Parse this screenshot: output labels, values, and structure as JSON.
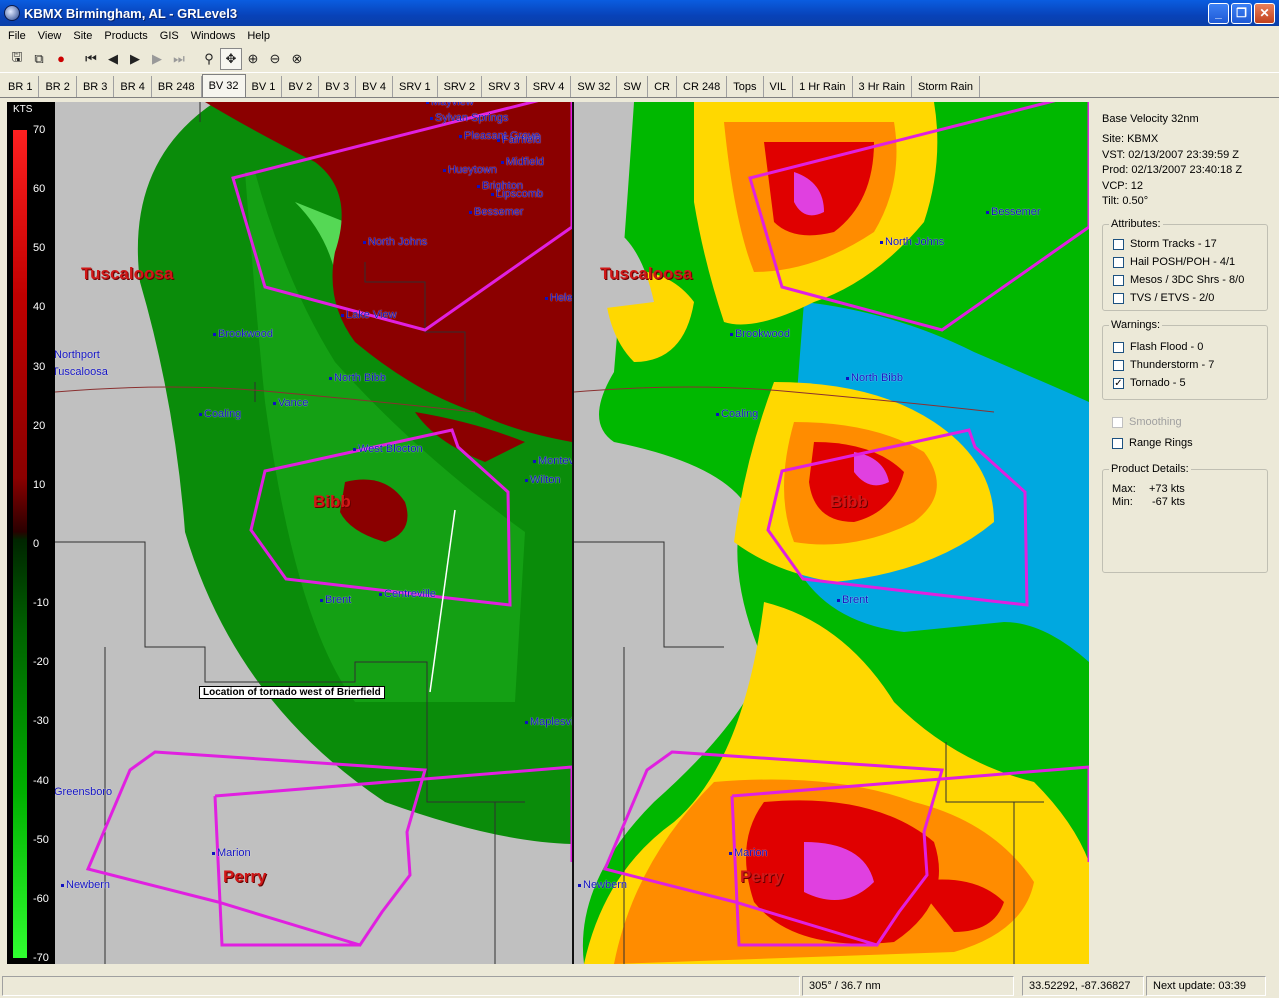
{
  "window": {
    "title": "KBMX Birmingham, AL - GRLevel3",
    "minimize": "_",
    "maximize": "❐",
    "close": "✕"
  },
  "menu": [
    "File",
    "View",
    "Site",
    "Products",
    "GIS",
    "Windows",
    "Help"
  ],
  "toolbar_icons": [
    "open-icon",
    "copy-icon",
    "delete-icon",
    "first-frame-icon",
    "prev-frame-icon",
    "play-icon",
    "next-frame-icon",
    "last-frame-icon",
    "zoom-icon",
    "pan-icon",
    "zoom-in-icon",
    "zoom-out-icon",
    "zoom-reset-icon"
  ],
  "tabs": [
    "BR 1",
    "BR 2",
    "BR 3",
    "BR 4",
    "BR 248",
    "BV 32",
    "BV 1",
    "BV 2",
    "BV 3",
    "BV 4",
    "SRV 1",
    "SRV 2",
    "SRV 3",
    "SRV 4",
    "SW 32",
    "SW",
    "CR",
    "CR 248",
    "Tops",
    "VIL",
    "1 Hr Rain",
    "3 Hr Rain",
    "Storm Rain"
  ],
  "active_tab": "BV 32",
  "scale": {
    "unit": "KTS",
    "labels": [
      "70",
      "60",
      "50",
      "40",
      "30",
      "20",
      "10",
      "0",
      "-10",
      "-20",
      "-30",
      "-40",
      "-50",
      "-60",
      "-70"
    ]
  },
  "counties": [
    "Tuscaloosa",
    "Bibb",
    "Perry"
  ],
  "cities": [
    "Mayview",
    "Sylvan Springs",
    "Pleasant Grove",
    "Fairfield",
    "Midfield",
    "Hueytown",
    "Brighton",
    "Lipscomb",
    "Bessemer",
    "North Johns",
    "Lake View",
    "Brookwood",
    "Northport",
    "Tuscaloosa",
    "North Bibb",
    "Vance",
    "Coaling",
    "West Blocton",
    "Montevallo",
    "Wilton",
    "Brent",
    "Centreville",
    "Maplesville",
    "Greensboro",
    "Marion",
    "Newbern",
    "Helena"
  ],
  "annotation": "Location of tornado west of Brierfield",
  "info": {
    "product": "Base Velocity 32nm",
    "site": "Site:  KBMX",
    "vst": "VST:  02/13/2007  23:39:59 Z",
    "prod": "Prod: 02/13/2007  23:40:18 Z",
    "vcp": "VCP:  12",
    "tilt": "Tilt:  0.50°",
    "attributes_title": "Attributes:",
    "attributes": [
      {
        "label": "Storm Tracks - 17",
        "checked": false
      },
      {
        "label": "Hail POSH/POH - 4/1",
        "checked": false
      },
      {
        "label": "Mesos / 3DC Shrs - 8/0",
        "checked": false
      },
      {
        "label": "TVS / ETVS - 2/0",
        "checked": false
      }
    ],
    "warnings_title": "Warnings:",
    "warnings": [
      {
        "label": "Flash Flood - 0",
        "checked": false
      },
      {
        "label": "Thunderstorm - 7",
        "checked": false
      },
      {
        "label": "Tornado - 5",
        "checked": true
      }
    ],
    "smoothing": "Smoothing",
    "range_rings": "Range Rings",
    "details_title": "Product Details:",
    "max_label": "Max:",
    "max_value": "+73 kts",
    "min_label": "Min:",
    "min_value": "-67 kts"
  },
  "status": {
    "bearing": "305° / 36.7 nm",
    "latlon": "33.52292, -87.36827",
    "next_update": "Next update: 03:39"
  },
  "colors": {
    "warning_polygon": "#e020e0",
    "inbound": "#008000",
    "outbound": "#8b0000",
    "background": "#c0c0c0"
  }
}
